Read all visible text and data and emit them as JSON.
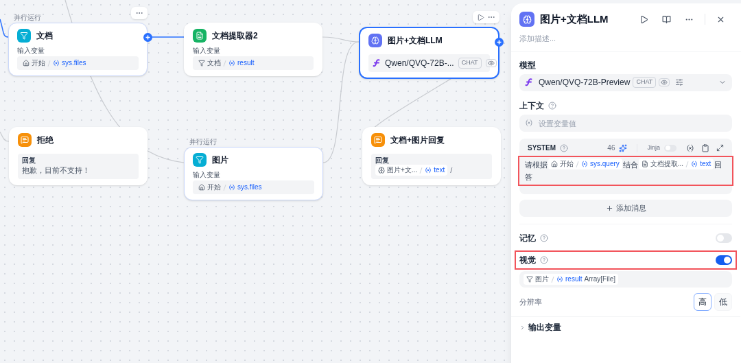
{
  "canvas": {
    "nodes": [
      {
        "kind": "filter",
        "title": "文档",
        "label_above": "并行运行",
        "selected": false,
        "body": {
          "kind": "input",
          "label": "输入变量",
          "chip": {
            "node": "开始",
            "var": "sys.files"
          }
        }
      },
      {
        "kind": "extractor",
        "title": "文档提取器2",
        "selected": false,
        "body": {
          "kind": "input",
          "label": "输入变量",
          "chip": {
            "node": "文档",
            "var": "result"
          }
        }
      },
      {
        "kind": "llm",
        "title": "图片+文档LLM",
        "selected": true,
        "body": {
          "kind": "model",
          "model": "Qwen/QVQ-72B-...",
          "tag": "CHAT",
          "vision": true
        }
      },
      {
        "kind": "reply",
        "title": "拒绝",
        "selected": false,
        "body": {
          "kind": "reply",
          "label": "回复",
          "text": "抱歉，目前不支持！"
        }
      },
      {
        "kind": "filter",
        "title": "图片",
        "label_above": "并行运行",
        "selected": false,
        "body": {
          "kind": "input",
          "label": "输入变量",
          "chip": {
            "node": "开始",
            "var": "sys.files"
          }
        }
      },
      {
        "kind": "reply",
        "title": "文档+图片回复",
        "selected": false,
        "body": {
          "kind": "reply",
          "label": "回复",
          "chip": {
            "node": "图片+文...",
            "var": "text"
          },
          "trail": "/"
        }
      }
    ]
  },
  "panel": {
    "title": "图片+文档LLM",
    "description_placeholder": "添加描述...",
    "model": {
      "label": "模型",
      "name": "Qwen/QVQ-72B-Preview",
      "tag": "CHAT",
      "vision": true
    },
    "context": {
      "label": "上下文",
      "placeholder": "设置变量值"
    },
    "system": {
      "label": "SYSTEM",
      "count": "46",
      "jinja_label": "Jinja",
      "jinja_on": false,
      "highlighted": true,
      "segments": [
        {
          "kind": "text",
          "text": "请根据"
        },
        {
          "kind": "var",
          "node": "开始",
          "var": "sys.query"
        },
        {
          "kind": "text",
          "text": "结合"
        },
        {
          "kind": "var",
          "node": "文档提取...",
          "var": "text"
        },
        {
          "kind": "text",
          "text": "回答"
        }
      ]
    },
    "add_message": "添加消息",
    "memory": {
      "label": "记忆",
      "on": false
    },
    "vision": {
      "label": "视觉",
      "on": true,
      "highlighted": true,
      "chip": {
        "node": "图片",
        "var": "result",
        "type": "Array[File]"
      }
    },
    "resolution": {
      "label": "分辨率",
      "options": [
        {
          "label": "高",
          "selected": true
        },
        {
          "label": "低",
          "selected": false
        }
      ]
    },
    "output": {
      "label": "输出变量",
      "expanded": false
    }
  }
}
